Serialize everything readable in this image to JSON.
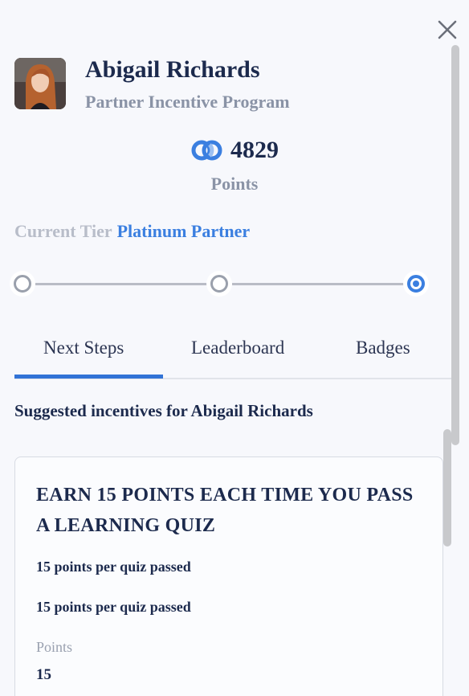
{
  "header": {
    "user_name": "Abigail Richards",
    "program_name": "Partner Incentive Program"
  },
  "points": {
    "value": "4829",
    "label": "Points",
    "icon": "points-coin-icon"
  },
  "tier": {
    "label": "Current Tier",
    "value": "Platinum Partner",
    "progress_steps_total": 3,
    "progress_step_current": 3
  },
  "tabs": [
    {
      "label": "Next Steps",
      "selected": true
    },
    {
      "label": "Leaderboard",
      "selected": false
    },
    {
      "label": "Badges",
      "selected": false
    }
  ],
  "suggested": {
    "title": "Suggested incentives for Abigail Richards"
  },
  "card": {
    "title": "EARN 15 POINTS EACH TIME YOU PASS A LEARNING QUIZ",
    "line1": "15 points per quiz passed",
    "line2": "15 points per quiz passed",
    "points_label": "Points",
    "points_value": "15"
  },
  "colors": {
    "accent": "#3b7fe0",
    "tab_indicator": "#3273d6",
    "title": "#1c2a4d",
    "muted": "#8a93a6"
  }
}
